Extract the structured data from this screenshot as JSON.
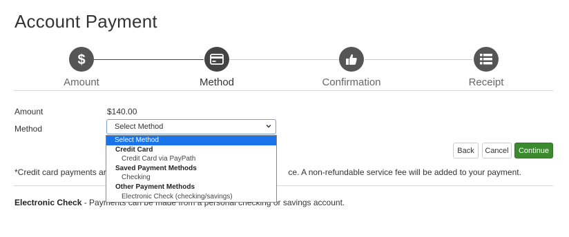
{
  "page": {
    "title": "Account Payment"
  },
  "steps": [
    {
      "label": "Amount",
      "icon": "dollar-icon",
      "active": false
    },
    {
      "label": "Method",
      "icon": "credit-card-icon",
      "active": true
    },
    {
      "label": "Confirmation",
      "icon": "thumbs-up-icon",
      "active": false
    },
    {
      "label": "Receipt",
      "icon": "list-icon",
      "active": false
    }
  ],
  "form": {
    "amount_label": "Amount",
    "amount_value": "$140.00",
    "method_label": "Method",
    "method_selected": "Select Method"
  },
  "dropdown": {
    "options": [
      {
        "text": "Select Method",
        "kind": "selected"
      },
      {
        "text": "Credit Card",
        "kind": "group"
      },
      {
        "text": "Credit Card via PayPath",
        "kind": "item"
      },
      {
        "text": "Saved Payment Methods",
        "kind": "group"
      },
      {
        "text": "Checking",
        "kind": "item"
      },
      {
        "text": "Other Payment Methods",
        "kind": "group"
      },
      {
        "text": "Electronic Check (checking/savings)",
        "kind": "item"
      }
    ]
  },
  "buttons": {
    "back": "Back",
    "cancel": "Cancel",
    "continue": "Continue"
  },
  "notes": {
    "card_note_start": "*Credit card payments are h",
    "card_note_end": "ce. A non-refundable service fee will be added to your payment.",
    "echeck_label": "Electronic Check",
    "echeck_text": " - Payments can be made from a personal checking or savings account."
  },
  "colors": {
    "step_circle": "#555555",
    "step_label_inactive": "#666666",
    "step_label_active": "#333333",
    "step_line_dark": "#444444",
    "step_line_light": "#cccccc",
    "select_highlight": "#1a73e8",
    "continue_button": "#3c8a2e"
  }
}
